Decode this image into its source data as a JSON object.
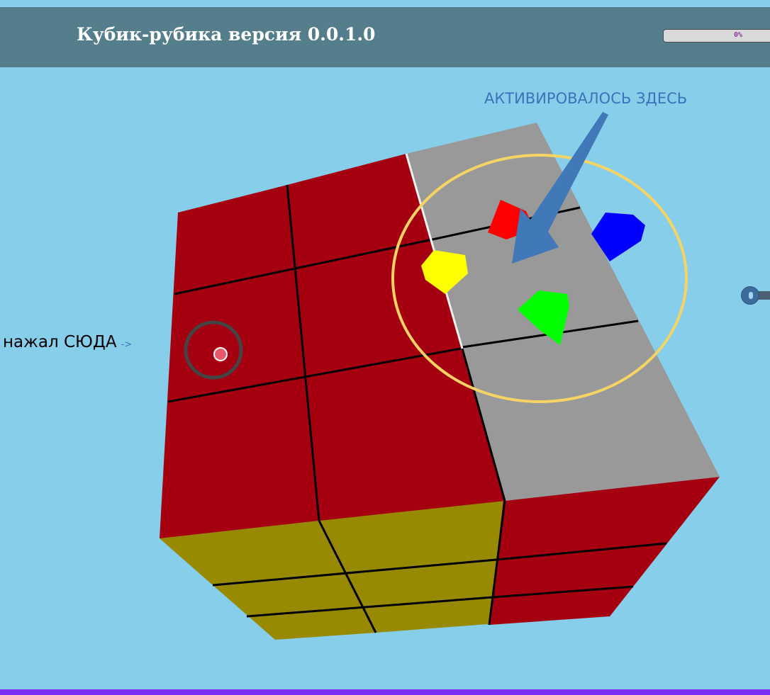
{
  "app": {
    "title": "Кубик-рубика версия 0.0.1.0"
  },
  "progress": {
    "label": "0%",
    "value": 0
  },
  "annotations": {
    "activated_here": "АКТИВИРОВАЛОСЬ ЗДЕСЬ",
    "clicked_here": "нажал СЮДА",
    "clicked_arrow": "->"
  },
  "cube": {
    "front_face_color": "#a50010",
    "top_face_color": "#999999",
    "bottom_face_color": "#978a00",
    "right_face_color": "#a50010",
    "grid_size": 3
  },
  "markers": {
    "red": "#ff0000",
    "blue": "#0000ff",
    "yellow": "#ffff00",
    "green": "#00ff00"
  },
  "annotation_colors": {
    "ellipse": "#f5d463",
    "arrow": "#4178b8",
    "click_ring": "#444444",
    "click_dot": "#e6576a"
  },
  "icons": {
    "side_widget": "toggle-knob-icon"
  }
}
